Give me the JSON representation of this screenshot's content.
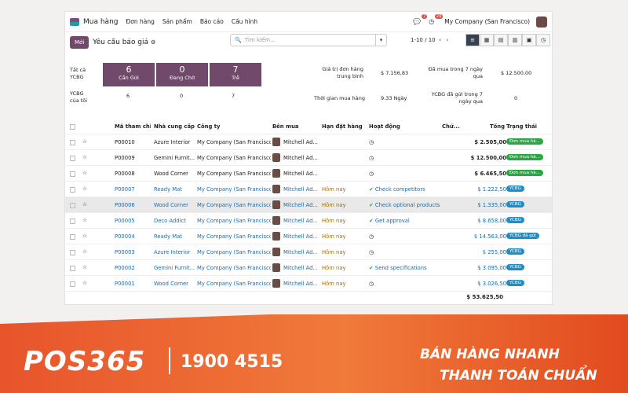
{
  "nav": {
    "app": "Mua hàng",
    "menu": [
      "Đơn hàng",
      "Sản phẩm",
      "Báo cáo",
      "Cấu hình"
    ],
    "msg_count": "7",
    "activity_count": "29",
    "company": "My Company (San Francisco)"
  },
  "control": {
    "new": "Mới",
    "breadcrumb": "Yêu cầu báo giá",
    "search_placeholder": "Tìm kiếm...",
    "pager": "1-10 / 10"
  },
  "dash": {
    "row1_label": "Tất cả\nYCBG",
    "row2_label": "YCBG\ncủa tôi",
    "tiles": [
      {
        "n": "6",
        "l": "Cần Gửi",
        "mine": "6"
      },
      {
        "n": "0",
        "l": "Đang Chờ",
        "mine": "0"
      },
      {
        "n": "7",
        "l": "Trễ",
        "mine": "7"
      }
    ],
    "avg_label": "Giá trị đơn hàng\ntrung bình",
    "avg": "$ 7.156,83",
    "lead_label": "Thời gian mua hàng",
    "lead": "9.33 Ngày",
    "bought_label": "Đã mua trong 7 ngày\nqua",
    "bought": "$ 12.500,00",
    "sent_label": "YCBG đã gửi trong 7\nngày qua",
    "sent": "0"
  },
  "table": {
    "headers": [
      "Mã tham chi...",
      "Nhà cung cấp",
      "Công ty",
      "Bên mua",
      "Hạn đặt hàng",
      "Hoạt động",
      "Chứ...",
      "Tổng",
      "Trạng thái"
    ],
    "rows": [
      {
        "ref": "P00010",
        "vendor": "Azure Interior",
        "company": "My Company (San Francisco)",
        "buyer": "Mitchell Ad...",
        "deadline": "",
        "activity": "",
        "total": "$ 2.505,00",
        "status": "Đơn mua hà...",
        "color": "green",
        "link": false
      },
      {
        "ref": "P00009",
        "vendor": "Gemini Furnit...",
        "company": "My Company (San Francisco)",
        "buyer": "Mitchell Ad...",
        "deadline": "",
        "activity": "",
        "total": "$ 12.500,00",
        "status": "Đơn mua hà...",
        "color": "green",
        "link": false
      },
      {
        "ref": "P00008",
        "vendor": "Wood Corner",
        "company": "My Company (San Francisco)",
        "buyer": "Mitchell Ad...",
        "deadline": "",
        "activity": "",
        "total": "$ 6.465,50",
        "status": "Đơn mua hà...",
        "color": "green",
        "link": false
      },
      {
        "ref": "P00007",
        "vendor": "Ready Mat",
        "company": "My Company (San Francisco)",
        "buyer": "Mitchell Ad...",
        "deadline": "Hôm nay",
        "activity": "Check competitors",
        "total": "$ 1.222,50",
        "status": "YCBG",
        "color": "blue",
        "link": true
      },
      {
        "ref": "P00006",
        "vendor": "Wood Corner",
        "company": "My Company (San Francisco)",
        "buyer": "Mitchell Ad...",
        "deadline": "Hôm nay",
        "activity": "Check optional products",
        "total": "$ 1.335,00",
        "status": "YCBG",
        "color": "blue",
        "link": true
      },
      {
        "ref": "P00005",
        "vendor": "Deco Addict",
        "company": "My Company (San Francisco)",
        "buyer": "Mitchell Ad...",
        "deadline": "Hôm nay",
        "activity": "Get approval",
        "total": "$ 8.658,00",
        "status": "YCBG",
        "color": "blue",
        "link": true
      },
      {
        "ref": "P00004",
        "vendor": "Ready Mat",
        "company": "My Company (San Francisco)",
        "buyer": "Mitchell Ad...",
        "deadline": "Hôm nay",
        "activity": "",
        "total": "$ 14.563,00",
        "status": "YCBG đã gửi",
        "color": "blue",
        "link": true
      },
      {
        "ref": "P00003",
        "vendor": "Azure Interior",
        "company": "My Company (San Francisco)",
        "buyer": "Mitchell Ad...",
        "deadline": "Hôm nay",
        "activity": "",
        "total": "$ 255,00",
        "status": "YCBG",
        "color": "blue",
        "link": true
      },
      {
        "ref": "P00002",
        "vendor": "Gemini Furnit...",
        "company": "My Company (San Francisco)",
        "buyer": "Mitchell Ad...",
        "deadline": "Hôm nay",
        "activity": "Send specifications",
        "total": "$ 3.095,00",
        "status": "YCBG",
        "color": "blue",
        "link": true
      },
      {
        "ref": "P00001",
        "vendor": "Wood Corner",
        "company": "My Company (San Francisco)",
        "buyer": "Mitchell Ad...",
        "deadline": "Hôm nay",
        "activity": "",
        "total": "$ 3.026,50",
        "status": "YCBG",
        "color": "blue",
        "link": true
      }
    ],
    "sum": "$ 53.625,50"
  },
  "banner": {
    "logo": "POS365",
    "hotline": "1900 4515",
    "tag1": "BÁN HÀNG NHANH",
    "tag2": "THANH TOÁN CHUẨN"
  }
}
